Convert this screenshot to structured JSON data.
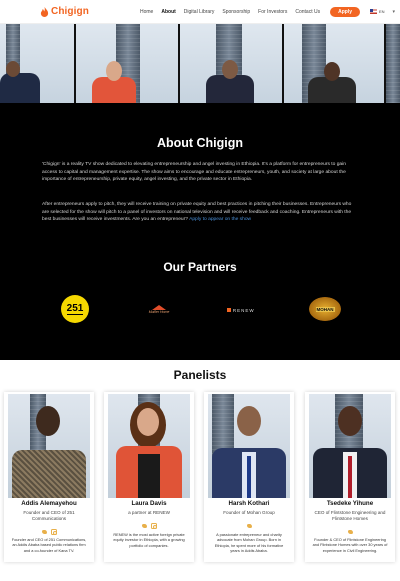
{
  "nav": {
    "logo_text": "Chigign",
    "links": [
      "Home",
      "About",
      "Digital Library",
      "Sponsorship",
      "For Investors",
      "Contact Us"
    ],
    "active_index": 1,
    "apply_label": "Apply",
    "lang_label": "EN"
  },
  "about": {
    "title": "About Chigign",
    "p1": "'Chigign' is a reality TV show dedicated to elevating entrepreneurship and angel investing in Ethiopia. It's a platform for entrepreneurs to gain access to capital and management expertise. The show aims to encourage and educate entrepreneurs, youth, and society at large about the importance of entrepreneurship, private equity, angel investing, and the private sector in Ethiopia.",
    "p2": "After entrepreneurs apply to pitch, they will receive training on private equity and best practices in pitching their businesses. Entrepreneurs who are selected for the show will pitch to a panel of investors on national television and will receive feedback and coaching. Entrepreneurs with the best businesses will receive investments. Are you an entrepreneur? ",
    "p2_link": "Apply to appear on the show"
  },
  "partners": {
    "title": "Our Partners",
    "items": [
      {
        "name": "251 Communications",
        "mark": "251"
      },
      {
        "name": "Muiller Homes",
        "mark": "Muiller Home"
      },
      {
        "name": "RENEW",
        "mark": "RENEW"
      },
      {
        "name": "Mohan Group",
        "mark": "MOHAN"
      }
    ]
  },
  "panelists": {
    "title": "Panelists",
    "cards": [
      {
        "name": "Addis Alemayehou",
        "role": "Founder and CEO of 251 Communications",
        "bio": "Founder and CEO of 251 Communications, an Addis Ababa based public relations firm and a co-founder of Kana TV."
      },
      {
        "name": "Laura Davis",
        "role": "a partner at RENEW",
        "bio": "RENEW is the most active foreign private equity investor in Ethiopia, with a growing portfolio of companies."
      },
      {
        "name": "Harsh Kothari",
        "role": "Founder of Mohan Group",
        "bio": "A passionate entrepreneur and charity advocate from Mohan Group. Born in Ethiopia, he spent more of his formative years in Addis Ababa."
      },
      {
        "name": "Tsedeke Yihune",
        "role": "CEO of Flintstone Engineering and Flintstone Homes",
        "bio": "Founder & CEO of Flintstone Engineering and Flintstone Homes with over 30 years of experience in Civil Engineering."
      }
    ]
  },
  "colors": {
    "brand": "#f26522",
    "link": "#4a90d9",
    "about_bg": "#000000",
    "icon_accent": "#e8b04a"
  }
}
